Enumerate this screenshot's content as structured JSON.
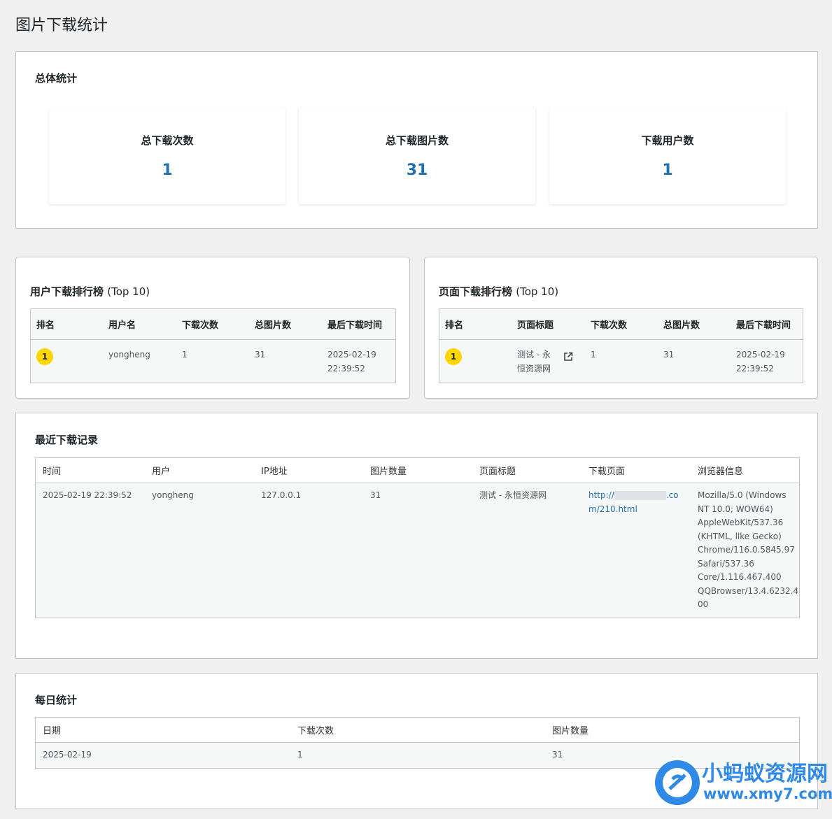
{
  "page_title": "图片下载统计",
  "overall": {
    "title": "总体统计",
    "cards": [
      {
        "label": "总下载次数",
        "value": "1"
      },
      {
        "label": "总下载图片数",
        "value": "31"
      },
      {
        "label": "下载用户数",
        "value": "1"
      }
    ]
  },
  "user_rank": {
    "title": "用户下载排行榜",
    "title_suffix": "(Top 10)",
    "headers": [
      "排名",
      "用户名",
      "下载次数",
      "总图片数",
      "最后下载时间"
    ],
    "rows": [
      {
        "rank": "1",
        "username": "yongheng",
        "downloads": "1",
        "images": "31",
        "last_date": "2025-02-19",
        "last_time": "22:39:52"
      }
    ]
  },
  "page_rank": {
    "title": "页面下载排行榜",
    "title_suffix": "(Top 10)",
    "headers": [
      "排名",
      "页面标题",
      "下载次数",
      "总图片数",
      "最后下载时间"
    ],
    "rows": [
      {
        "rank": "1",
        "page_title_l1": "测试 - 永",
        "page_title_l2": "恒资源网",
        "link_icon": "external-link-icon",
        "downloads": "1",
        "images": "31",
        "last_date": "2025-02-19",
        "last_time": "22:39:52"
      }
    ]
  },
  "recent": {
    "title": "最近下载记录",
    "headers": [
      "时间",
      "用户",
      "IP地址",
      "图片数量",
      "页面标题",
      "下载页面",
      "浏览器信息"
    ],
    "rows": [
      {
        "time": "2025-02-19 22:39:52",
        "user": "yongheng",
        "ip": "127.0.0.1",
        "count": "31",
        "page_title": "测试 - 永恒资源网",
        "url_prefix": "http://",
        "url_suffix_l1": ".co",
        "url_l2": "m/210.html",
        "browser_lines": [
          "Mozilla/5.0 (Windows",
          "NT 10.0; WOW64)",
          "AppleWebKit/537.36",
          "(KHTML, like Gecko)",
          "Chrome/116.0.5845.97",
          "Safari/537.36",
          "Core/1.116.467.400",
          "QQBrowser/13.4.6232.4",
          "00"
        ]
      }
    ]
  },
  "daily": {
    "title": "每日统计",
    "headers": [
      "日期",
      "下载次数",
      "图片数量"
    ],
    "rows": [
      {
        "date": "2025-02-19",
        "downloads": "1",
        "images": "31"
      }
    ]
  },
  "watermark": {
    "name": "小蚂蚁资源网",
    "url": "www.xmy7.com"
  },
  "colors": {
    "accent": "#2271b1",
    "badge": "#ffd700",
    "background": "#f0f0f1"
  }
}
